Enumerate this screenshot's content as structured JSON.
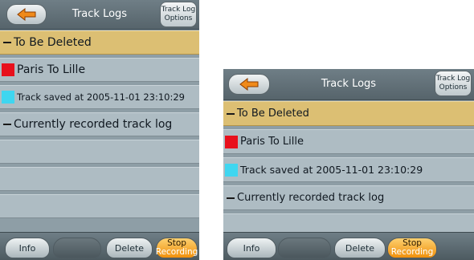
{
  "screens": [
    {
      "title": "Track Logs",
      "back_icon": "back-arrow-icon",
      "options_line1": "Track Log",
      "options_line2": "Options",
      "items": [
        {
          "label": "To Be Deleted",
          "marker": "dash",
          "selected": true
        },
        {
          "label": "Paris To Lille",
          "marker": "red"
        },
        {
          "label": "Track saved at 2005-11-01 23:10:29",
          "marker": "cyan"
        },
        {
          "label": "Currently recorded track log",
          "marker": "dash"
        }
      ],
      "buttons": {
        "info": "Info",
        "delete": "Delete",
        "stop_line1": "Stop",
        "stop_line2": "Recording"
      }
    },
    {
      "title": "Track Logs",
      "back_icon": "back-arrow-icon",
      "options_line1": "Track Log",
      "options_line2": "Options",
      "items": [
        {
          "label": "To Be Deleted",
          "marker": "dash",
          "selected": true
        },
        {
          "label": "Paris To Lille",
          "marker": "red"
        },
        {
          "label": "Track saved at 2005-11-01 23:10:29",
          "marker": "cyan"
        },
        {
          "label": "Currently recorded track log",
          "marker": "dash"
        }
      ],
      "buttons": {
        "info": "Info",
        "delete": "Delete",
        "stop_line1": "Stop",
        "stop_line2": "Recording"
      }
    }
  ],
  "colors": {
    "selected_row": "#dcbf73",
    "red_marker": "#e8101c",
    "cyan_marker": "#3fd6f0",
    "stop_button": "#f0900c"
  }
}
